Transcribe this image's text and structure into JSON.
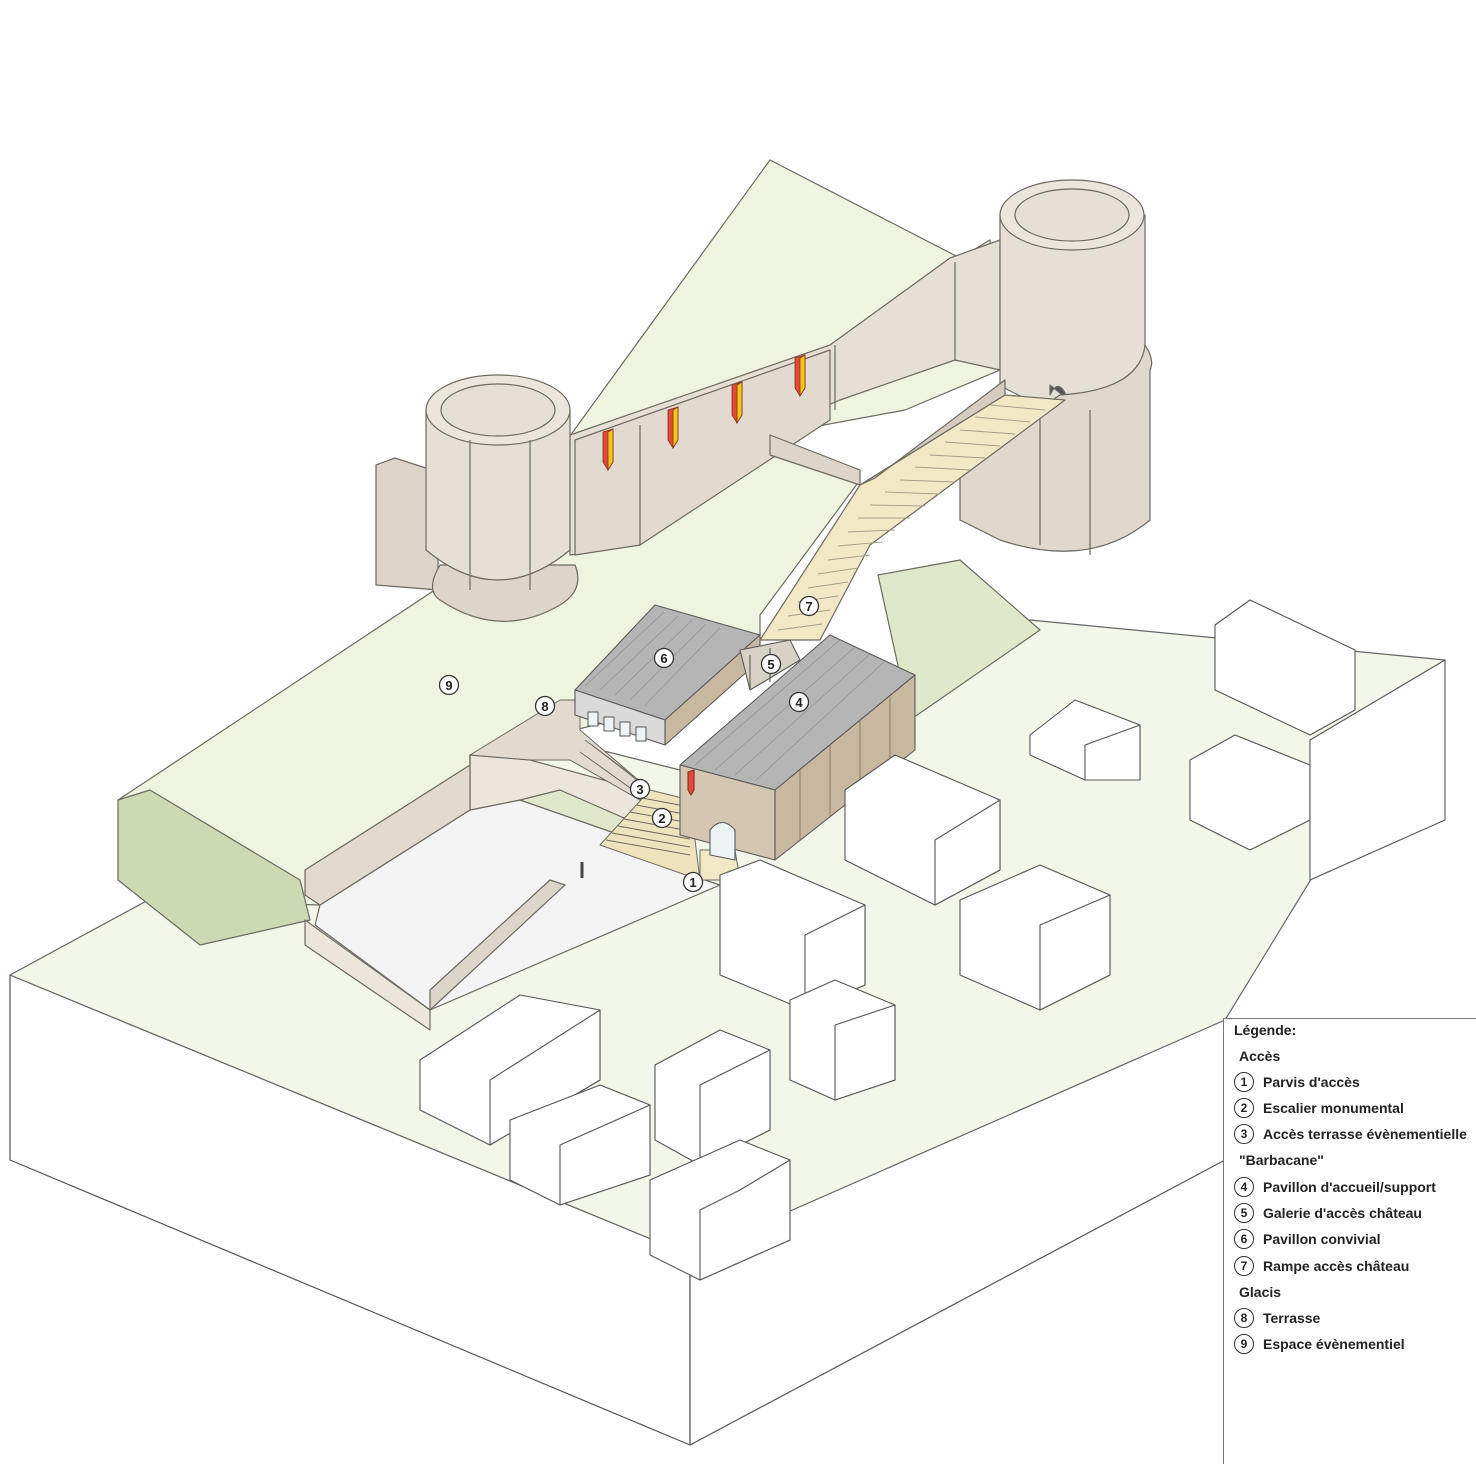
{
  "colors": {
    "grass": "#eef4df",
    "grass_edge": "#d6e2bd",
    "wall": "#e6dfd5",
    "wall_shade": "#d6cdc0",
    "stone_outline": "#8a847b",
    "stair": "#f3e8c6",
    "roof": "#b5b5b5",
    "timber": "#c9b8a0",
    "plaza": "#f4f4f4",
    "banner_red": "#e14b3b",
    "banner_yellow": "#f3c615"
  },
  "callouts": [
    {
      "id": "1",
      "label": "1"
    },
    {
      "id": "2",
      "label": "2"
    },
    {
      "id": "3",
      "label": "3"
    },
    {
      "id": "4",
      "label": "4"
    },
    {
      "id": "5",
      "label": "5"
    },
    {
      "id": "6",
      "label": "6"
    },
    {
      "id": "7",
      "label": "7"
    },
    {
      "id": "8",
      "label": "8"
    },
    {
      "id": "9",
      "label": "9"
    }
  ],
  "legend": {
    "title": "Légende:",
    "group_acces": "Accès",
    "group_glacis": "Glacis",
    "items": [
      {
        "num": "1",
        "label": "Parvis d'accès"
      },
      {
        "num": "2",
        "label": "Escalier monumental"
      },
      {
        "num": "3",
        "label": "Accès terrasse évènementielle",
        "continuation": "\"Barbacane\""
      },
      {
        "num": "4",
        "label": "Pavillon d'accueil/support"
      },
      {
        "num": "5",
        "label": "Galerie d'accès château"
      },
      {
        "num": "6",
        "label": "Pavillon convivial"
      },
      {
        "num": "7",
        "label": "Rampe accès château"
      },
      {
        "num": "8",
        "label": "Terrasse"
      },
      {
        "num": "9",
        "label": "Espace évènementiel"
      }
    ]
  }
}
